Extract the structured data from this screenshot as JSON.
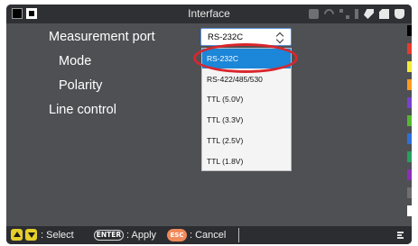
{
  "window": {
    "title": "Interface"
  },
  "settings": {
    "measurement_port": "Measurement port",
    "mode": "Mode",
    "polarity": "Polarity",
    "line_control": "Line control"
  },
  "port_select": {
    "value": "RS-232C",
    "options": [
      "RS-232C",
      "RS-422/485/530",
      "TTL (5.0V)",
      "TTL (3.3V)",
      "TTL (2.5V)",
      "TTL (1.8V)"
    ],
    "selected_index": 0
  },
  "status_icons": [
    "printer-icon",
    "wifi-icon",
    "network-icon",
    "usb-icon",
    "tool-icon",
    "sd-card-icon",
    "power-plug-icon"
  ],
  "color_strip": [
    "#000000",
    "#e63c2b",
    "#f2eb3a",
    "#ff9a1e",
    "#7a3fd0",
    "#55b82e",
    "#2f6fd8",
    "#27a05f",
    "#8c2fb6",
    "#6f6f6f",
    "#ffffff"
  ],
  "bottom_bar": {
    "select_label": ": Select",
    "enter_key": "ENTER",
    "apply_label": ": Apply",
    "esc_key": "ESC",
    "cancel_label": ": Cancel"
  },
  "colors": {
    "background": "#4f5054",
    "highlight": "#1c86d8",
    "annotation_ring": "#d9262c"
  }
}
